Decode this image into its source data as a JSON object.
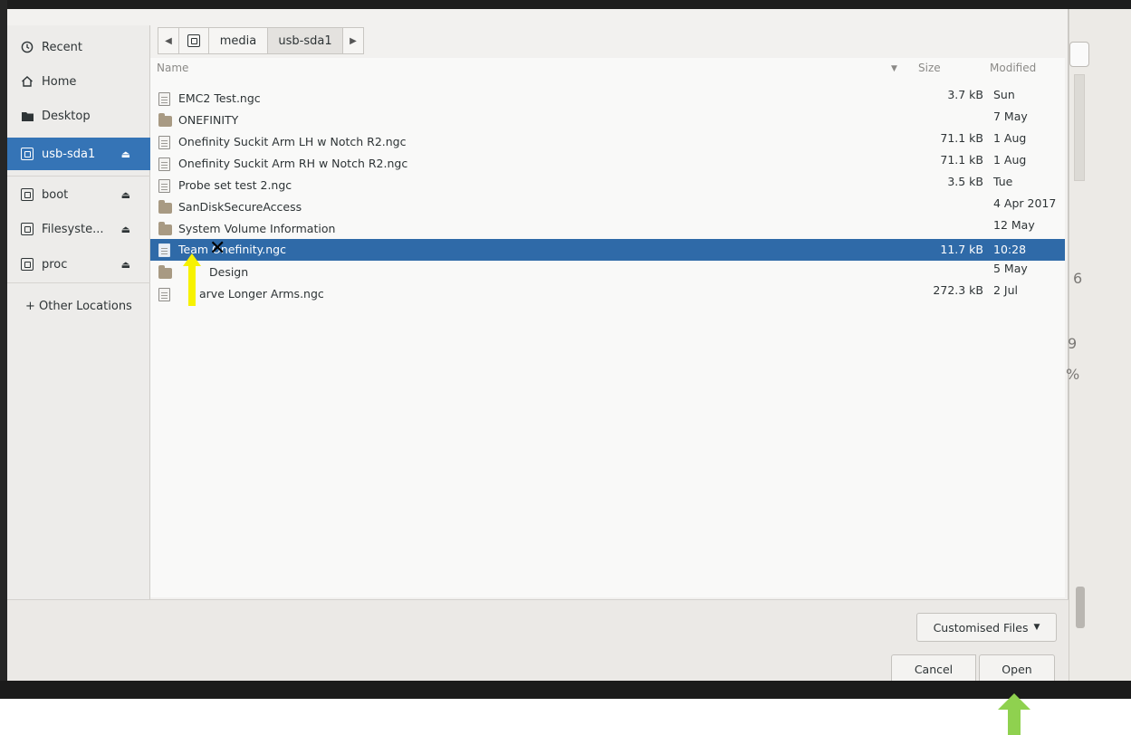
{
  "sidebar": {
    "items": [
      {
        "label": "Recent",
        "icon": "clock-icon"
      },
      {
        "label": "Home",
        "icon": "home-icon"
      },
      {
        "label": "Desktop",
        "icon": "folder-icon"
      },
      {
        "label": "usb-sda1",
        "icon": "drive-icon",
        "eject": true,
        "active": true
      },
      {
        "label": "boot",
        "icon": "drive-icon",
        "eject": true
      },
      {
        "label": "Filesyste...",
        "icon": "drive-icon",
        "eject": true
      },
      {
        "label": "proc",
        "icon": "drive-icon",
        "eject": true
      }
    ],
    "other_locations": "+ Other Locations"
  },
  "pathbar": {
    "segments": [
      "media",
      "usb-sda1"
    ]
  },
  "filelist": {
    "columns": {
      "name": "Name",
      "size": "Size",
      "modified": "Modified"
    },
    "rows": [
      {
        "name": "EMC2 Test.ngc",
        "size": "3.7 kB",
        "modified": "Sun",
        "type": "file"
      },
      {
        "name": "ONEFINITY",
        "size": "",
        "modified": "7 May",
        "type": "folder"
      },
      {
        "name": "Onefinity Suckit Arm LH w Notch R2.ngc",
        "size": "71.1 kB",
        "modified": "1 Aug",
        "type": "file"
      },
      {
        "name": "Onefinity Suckit Arm RH w Notch R2.ngc",
        "size": "71.1 kB",
        "modified": "1 Aug",
        "type": "file"
      },
      {
        "name": "Probe set test 2.ngc",
        "size": "3.5 kB",
        "modified": "Tue",
        "type": "file"
      },
      {
        "name": "SanDiskSecureAccess",
        "size": "",
        "modified": "4 Apr 2017",
        "type": "folder"
      },
      {
        "name": "System Volume Information",
        "size": "",
        "modified": "12 May",
        "type": "folder"
      },
      {
        "name": "Team Onefinity.ngc",
        "size": "11.7 kB",
        "modified": "10:28",
        "type": "file",
        "selected": true
      },
      {
        "name": "Design",
        "size": "",
        "modified": "5 May",
        "type": "folder"
      },
      {
        "name": "arve Longer Arms.ngc",
        "size": "272.3 kB",
        "modified": "2 Jul",
        "type": "file"
      }
    ]
  },
  "footer": {
    "filter": "Customised Files",
    "cancel": "Cancel",
    "open": "Open"
  },
  "background": {
    "fragments": [
      "6",
      "9",
      "%"
    ]
  },
  "annotations": {
    "x_mark": "✕",
    "yellow": "#f7f200",
    "green": "#8fd14f"
  }
}
